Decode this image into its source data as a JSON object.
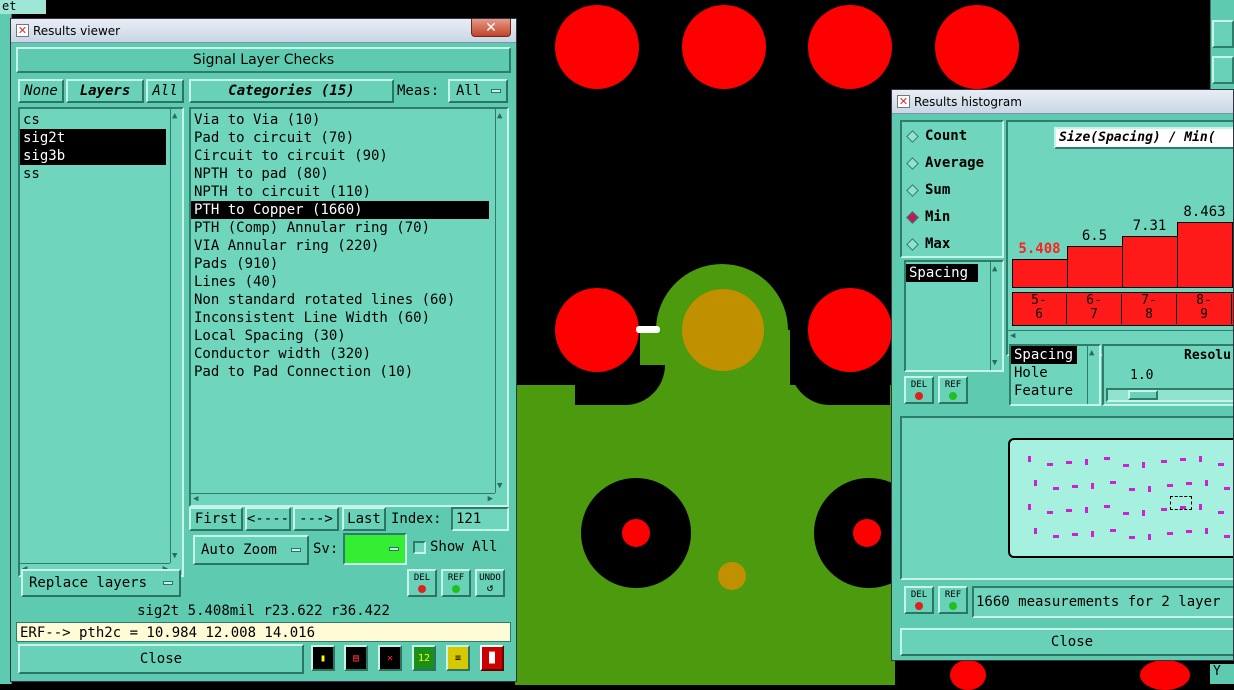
{
  "colors": {
    "panel": "#5ecbb0",
    "copper_green": "#4c9a0e",
    "pad_red": "#ff0000",
    "pad_gold": "#c09000",
    "highlight": "#ff1a1a"
  },
  "background_menu": {
    "top_left_text": "et"
  },
  "results_viewer": {
    "title": "Results viewer",
    "header": "Signal Layer Checks",
    "layers_none": "None",
    "layers_label": "Layers",
    "layers_all": "All",
    "layers": [
      {
        "name": "cs",
        "selected": false
      },
      {
        "name": "sig2t",
        "selected": true
      },
      {
        "name": "sig3b",
        "selected": true
      },
      {
        "name": "ss",
        "selected": false
      }
    ],
    "categories_label": "Categories (15)",
    "meas_label": "Meas:",
    "meas_value": "All",
    "categories": [
      {
        "text": "Via to Via (10)",
        "selected": false
      },
      {
        "text": "Pad to circuit (70)",
        "selected": false
      },
      {
        "text": "Circuit to circuit (90)",
        "selected": false
      },
      {
        "text": "NPTH to pad (80)",
        "selected": false
      },
      {
        "text": "NPTH to circuit (110)",
        "selected": false
      },
      {
        "text": "PTH to Copper (1660)",
        "selected": true
      },
      {
        "text": "PTH (Comp) Annular ring (70)",
        "selected": false
      },
      {
        "text": "VIA Annular ring (220)",
        "selected": false
      },
      {
        "text": "Pads (910)",
        "selected": false
      },
      {
        "text": "Lines (40)",
        "selected": false
      },
      {
        "text": "Non standard rotated lines (60)",
        "selected": false
      },
      {
        "text": "Inconsistent Line Width (60)",
        "selected": false
      },
      {
        "text": "Local Spacing (30)",
        "selected": false
      },
      {
        "text": "Conductor width (320)",
        "selected": false
      },
      {
        "text": "Pad to Pad Connection (10)",
        "selected": false
      }
    ],
    "first": "First",
    "prev": "<----",
    "next": "--->",
    "last": "Last",
    "index_label": "Index:",
    "index_value": "121",
    "auto_zoom": "Auto Zoom",
    "sv_label": "Sv:",
    "sv_color": "#33ee33",
    "show_all": "Show All",
    "replace_layers": "Replace layers",
    "del": "DEL",
    "ref": "REF",
    "undo": "UNDO",
    "status": "sig2t 5.408mil  r23.622  r36.422",
    "erf": "ERF--> pth2c = 10.984 12.008 14.016",
    "close": "Close",
    "toolbar_icons": [
      "highlight-icon",
      "report-icon",
      "exclude-icon",
      "counter-icon",
      "notes-icon",
      "histogram-icon"
    ]
  },
  "histogram": {
    "title": "Results histogram",
    "options": [
      {
        "label": "Count",
        "checked": false
      },
      {
        "label": "Average",
        "checked": false
      },
      {
        "label": "Sum",
        "checked": false
      },
      {
        "label": "Min",
        "checked": true
      },
      {
        "label": "Max",
        "checked": false
      }
    ],
    "chart_title": "Size(Spacing) / Min(",
    "bars": [
      {
        "label": "5.408",
        "value": 5.408,
        "range": "5-6"
      },
      {
        "label": "6.5",
        "value": 6.5,
        "range": "6-7"
      },
      {
        "label": "7.31",
        "value": 7.31,
        "range": "7-8"
      },
      {
        "label": "8.463",
        "value": 8.463,
        "range": "8-9"
      }
    ],
    "range_parts": [
      [
        "5-",
        "6"
      ],
      [
        "6-",
        "7"
      ],
      [
        "7-",
        "8"
      ],
      [
        "8-",
        "9"
      ]
    ],
    "list": [
      {
        "text": "Spacing",
        "selected": true
      }
    ],
    "attrs": [
      {
        "text": "Spacing",
        "selected": true
      },
      {
        "text": "Hole",
        "selected": false
      },
      {
        "text": "Feature",
        "selected": false
      }
    ],
    "resolution_label": "Resolu",
    "resolution_value": "1.0",
    "del": "DEL",
    "ref": "REF",
    "summary": "1660 measurements for 2 layer",
    "close": "Close",
    "corner_text": "Y"
  },
  "chart_data": {
    "type": "bar",
    "title": "Size(Spacing) / Min(",
    "categories": [
      "5-6",
      "6-7",
      "7-8",
      "8-9"
    ],
    "values": [
      5.408,
      6.5,
      7.31,
      8.463
    ]
  }
}
